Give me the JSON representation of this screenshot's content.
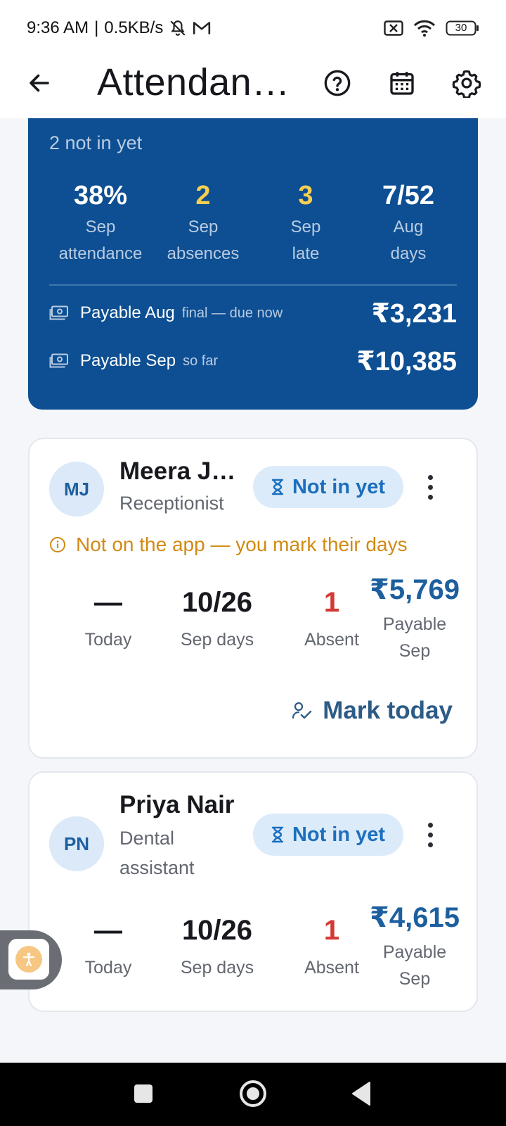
{
  "status_bar": {
    "time": "9:36 AM",
    "separator": "|",
    "network_speed": "0.5KB/s",
    "battery": "30",
    "icons": [
      "notifications-off-icon",
      "gmail-icon",
      "no-sim-icon",
      "wifi-icon",
      "battery-icon"
    ]
  },
  "app_bar": {
    "title": "Attendan…",
    "actions": [
      "help-icon",
      "calendar-icon",
      "settings-icon"
    ]
  },
  "summary": {
    "not_in_yet": "2 not in yet",
    "stats": [
      {
        "value": "38%",
        "label1": "Sep",
        "label2": "attendance",
        "color": "#ffffff"
      },
      {
        "value": "2",
        "label1": "Sep",
        "label2": "absences",
        "color": "#f6cf52"
      },
      {
        "value": "3",
        "label1": "Sep",
        "label2": "late",
        "color": "#f6cf52"
      },
      {
        "value": "7/52",
        "label1": "Aug",
        "label2": "days",
        "color": "#ffffff"
      }
    ],
    "payables": [
      {
        "label": "Payable Aug",
        "sub": "final — due now",
        "amount": "₹3,231"
      },
      {
        "label": "Payable Sep",
        "sub": "so far",
        "amount": "₹10,385"
      }
    ]
  },
  "employees": [
    {
      "initials": "MJ",
      "name": "Meera J…",
      "role": "Receptionist",
      "status": "Not in yet",
      "warning": "Not on the app — you mark their days",
      "today": "—",
      "today_label": "Today",
      "sep_days": "10/26",
      "sep_days_label": "Sep days",
      "absent": "1",
      "absent_label": "Absent",
      "payable": "₹5,769",
      "payable_label1": "Payable",
      "payable_label2": "Sep",
      "action": "Mark today"
    },
    {
      "initials": "PN",
      "name": "Priya Nair",
      "role1": "Dental",
      "role2": "assistant",
      "status": "Not in yet",
      "today": "—",
      "today_label": "Today",
      "sep_days": "10/26",
      "sep_days_label": "Sep days",
      "absent": "1",
      "absent_label": "Absent",
      "payable": "₹4,615",
      "payable_label1": "Payable",
      "payable_label2": "Sep"
    }
  ],
  "colors": {
    "summary_bg": "#0d4f92",
    "accent_blue": "#1b6fbd",
    "warning": "#d18a14",
    "absent_red": "#d33a34",
    "highlight_yellow": "#f6cf52"
  }
}
